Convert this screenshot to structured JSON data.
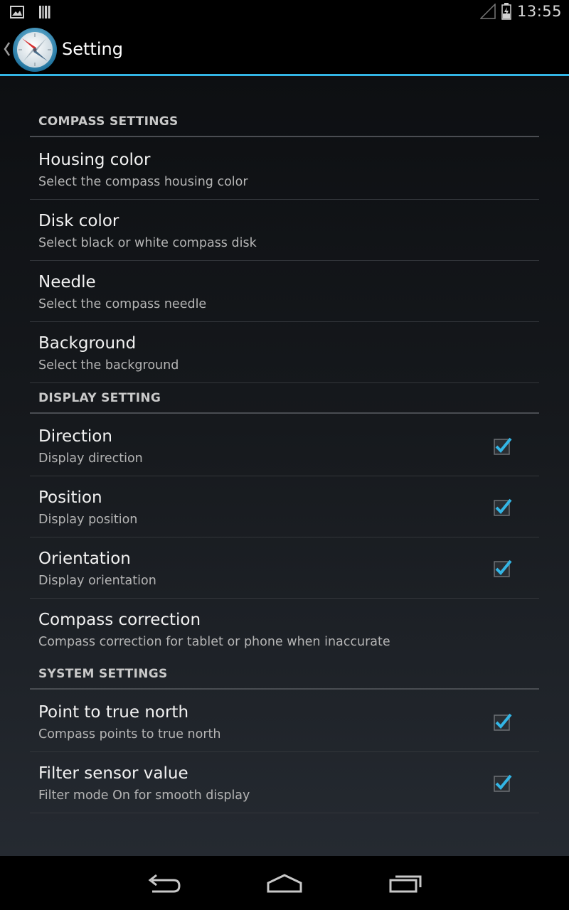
{
  "status_bar": {
    "time": "13:55",
    "icons": [
      "gallery-notification-icon",
      "barcode-notification-icon",
      "signal-icon",
      "battery-charging-icon"
    ]
  },
  "action_bar": {
    "title": "Setting",
    "icons": [
      "up-caret-icon",
      "compass-app-icon"
    ],
    "accent_color": "#33b5e5"
  },
  "sections": [
    {
      "header": "COMPASS SETTINGS",
      "items": [
        {
          "title": "Housing color",
          "summary": "Select the compass housing color"
        },
        {
          "title": "Disk color",
          "summary": "Select black or white compass disk"
        },
        {
          "title": "Needle",
          "summary": "Select the compass needle"
        },
        {
          "title": "Background",
          "summary": "Select the background"
        }
      ]
    },
    {
      "header": "DISPLAY SETTING",
      "items": [
        {
          "title": "Direction",
          "summary": "Display direction",
          "checked": true
        },
        {
          "title": "Position",
          "summary": "Display position",
          "checked": true
        },
        {
          "title": "Orientation",
          "summary": "Display orientation",
          "checked": true
        },
        {
          "title": "Compass correction",
          "summary": "Compass correction for tablet or phone when inaccurate"
        }
      ]
    },
    {
      "header": "SYSTEM SETTINGS",
      "items": [
        {
          "title": "Point to true north",
          "summary": "Compass points to true north",
          "checked": true
        },
        {
          "title": "Filter sensor value",
          "summary": "Filter mode On for smooth display",
          "checked": true
        }
      ]
    }
  ],
  "nav_bar": {
    "icons": [
      "back-icon",
      "home-icon",
      "recent-apps-icon"
    ]
  }
}
